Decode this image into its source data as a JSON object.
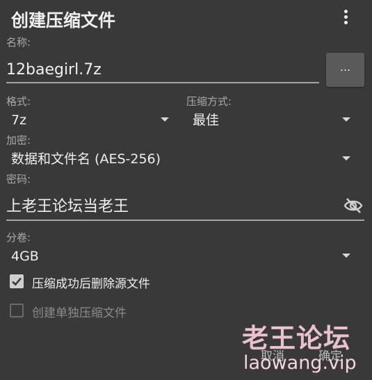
{
  "dialog": {
    "title": "创建压缩文件"
  },
  "name": {
    "label": "名称:",
    "value": "12baegirl.7z",
    "browse_label": "..."
  },
  "format": {
    "label": "格式:",
    "value": "7z"
  },
  "method": {
    "label": "压缩方式:",
    "value": "最佳"
  },
  "encryption": {
    "label": "加密:",
    "value": "数据和文件名 (AES-256)"
  },
  "password": {
    "label": "密码:",
    "value": "上老王论坛当老王"
  },
  "split": {
    "label": "分卷:",
    "value": "4GB"
  },
  "options": {
    "delete_after": {
      "label": "压缩成功后删除源文件",
      "checked": true
    },
    "separate": {
      "label": "创建单独压缩文件",
      "checked": false
    }
  },
  "actions": {
    "cancel": "取消",
    "ok": "确定"
  },
  "watermark": {
    "title": "老王论坛",
    "url": "laowang.vip"
  },
  "icons": {
    "menu": "more-vert-icon",
    "visibility": "visibility-off-icon",
    "dropdown": "chevron-down-icon",
    "check": "check-icon"
  }
}
